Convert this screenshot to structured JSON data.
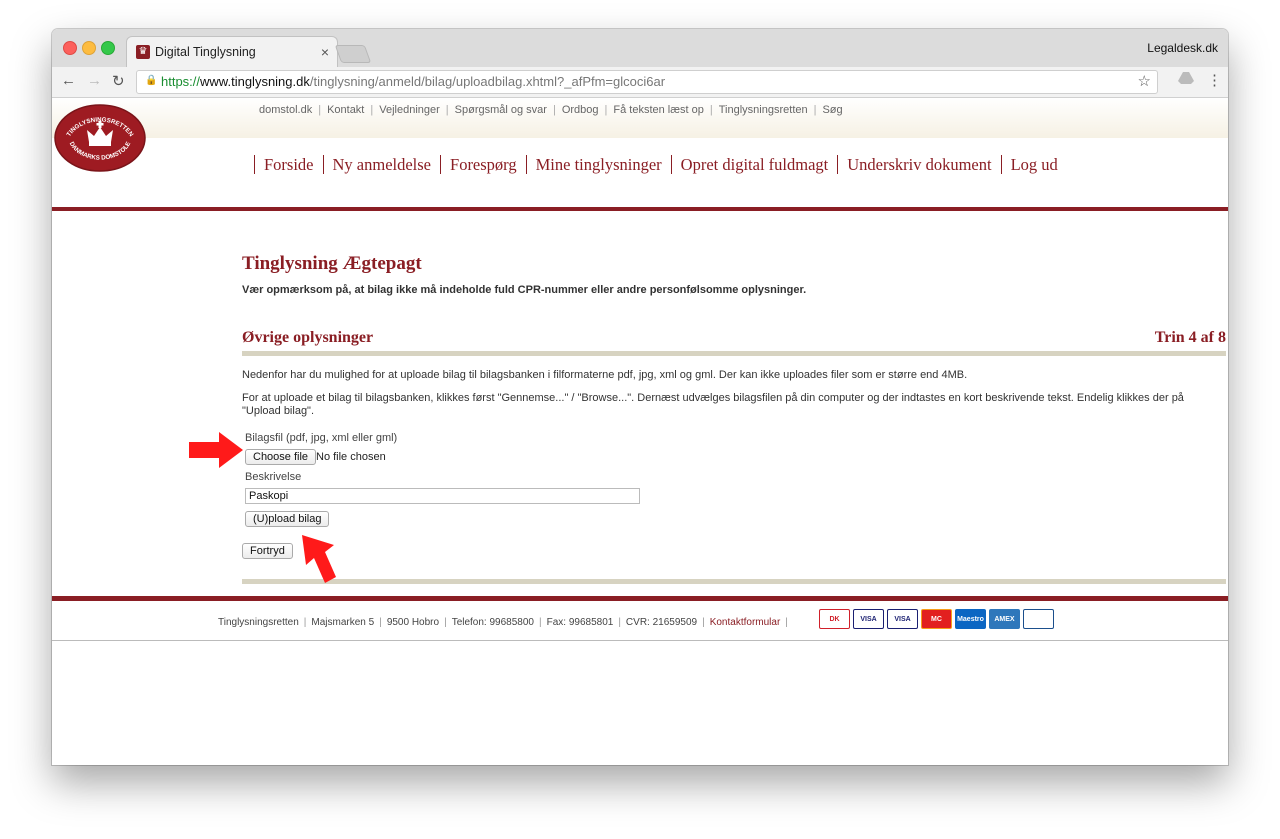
{
  "browser": {
    "tab_title": "Digital Tinglysning",
    "tab_close": "×",
    "profile_name": "Legaldesk.dk",
    "url_scheme": "https://",
    "url_host": "www.tinglysning.dk",
    "url_path": "/tinglysning/anmeld/bilag/uploadbilag.xhtml?_afPfm=glcoci6ar",
    "back_glyph": "←",
    "forward_glyph": "→",
    "reload_glyph": "↻",
    "star_glyph": "☆",
    "menu_glyph": "⋮"
  },
  "header": {
    "seal_top_text": "TINGLYSNINGSRETTEN",
    "seal_bottom_text": "DANMARKS DOMSTOLE",
    "top_links": [
      "domstol.dk",
      "Kontakt",
      "Vejledninger",
      "Spørgsmål og svar",
      "Ordbog",
      "Få teksten læst op",
      "Tinglysningsretten",
      "Søg"
    ],
    "nav": [
      "Forside",
      "Ny anmeldelse",
      "Forespørg",
      "Mine tinglysninger",
      "Opret digital fuldmagt",
      "Underskriv dokument",
      "Log ud"
    ]
  },
  "main": {
    "title": "Tinglysning Ægtepagt",
    "warning": "Vær opmærksom på, at bilag ikke må indeholde fuld CPR-nummer eller andre personfølsomme oplysninger.",
    "section_title": "Øvrige oplysninger",
    "step_label": "Trin 4 af 8",
    "para1": "Nedenfor har du mulighed for at uploade bilag til bilagsbanken i filformaterne pdf, jpg, xml og gml. Der kan ikke uploades filer som er større end 4MB.",
    "para2": "For at uploade et bilag til bilagsbanken, klikkes først \"Gennemse...\" / \"Browse...\". Dernæst udvælges bilagsfilen på din computer og der indtastes en kort beskrivende tekst. Endelig klikkes der på \"Upload bilag\".",
    "file_label": "Bilagsfil (pdf, jpg, xml eller gml)",
    "choose_file": "Choose file",
    "no_file": "No file chosen",
    "desc_label": "Beskrivelse",
    "desc_value": "Paskopi",
    "upload_button": "(U)pload bilag",
    "cancel_button": "Fortryd"
  },
  "footer": {
    "items": [
      "Tinglysningsretten",
      "Majsmarken 5",
      "9500 Hobro",
      "Telefon: 99685800",
      "Fax: 99685801",
      "CVR: 21659509"
    ],
    "contact_link": "Kontaktformular",
    "cards": [
      {
        "label": "DK",
        "bg": "#ffffff",
        "fg": "#d0202a",
        "border": "#d0202a"
      },
      {
        "label": "VISA",
        "bg": "#ffffff",
        "fg": "#1a1f71",
        "border": "#1a1f71"
      },
      {
        "label": "VISA",
        "bg": "#ffffff",
        "fg": "#1a1f71",
        "border": "#1a1f71"
      },
      {
        "label": "MC",
        "bg": "#e2201f",
        "fg": "#ffffff",
        "border": "#f79e1b"
      },
      {
        "label": "Maestro",
        "bg": "#0b66c3",
        "fg": "#ffffff",
        "border": "#0b66c3"
      },
      {
        "label": "AMEX",
        "bg": "#2e77bb",
        "fg": "#ffffff",
        "border": "#2e77bb"
      },
      {
        "label": "",
        "bg": "#ffffff",
        "fg": "#1b4f8c",
        "border": "#1b4f8c"
      }
    ]
  },
  "colors": {
    "brand": "#8a1e24",
    "annotation_arrow": "#ff1a1a",
    "beige_rule": "#d7d3c1"
  }
}
